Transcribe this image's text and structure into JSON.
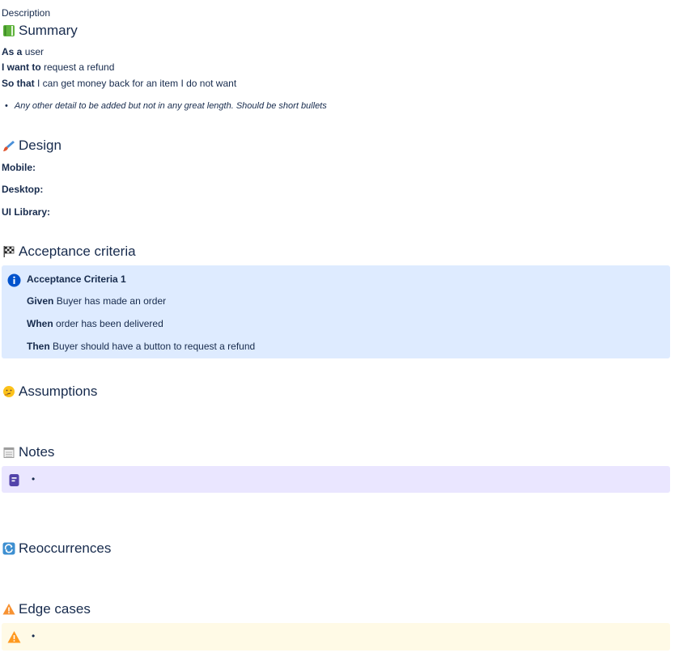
{
  "label": "Description",
  "summary": {
    "heading": "Summary",
    "icon": "green-book-icon",
    "as_a_label": "As a",
    "as_a_value": "user",
    "i_want_label": "I want to",
    "i_want_value": "request a refund",
    "so_that_label": "So that",
    "so_that_value": "I can get money back for an item I do not want",
    "bullet": "Any other detail to be added but not in any great length. Should be short bullets"
  },
  "design": {
    "heading": "Design",
    "icon": "paintbrush-icon",
    "mobile": "Mobile:",
    "desktop": "Desktop:",
    "ui_library": "UI Library:"
  },
  "acceptance": {
    "heading": "Acceptance criteria",
    "icon": "checkered-flag-icon",
    "panel": {
      "title": "Acceptance Criteria 1",
      "given_label": "Given",
      "given_value": "Buyer has made an order",
      "when_label": "When",
      "when_value": "order has been delivered",
      "then_label": "Then",
      "then_value": "Buyer should have a button to request a refund",
      "color": "#deebff"
    }
  },
  "assumptions": {
    "heading": "Assumptions",
    "icon": "thinking-face-icon"
  },
  "notes": {
    "heading": "Notes",
    "icon": "spiral-notepad-icon",
    "bullet": "•",
    "color": "#eae6ff"
  },
  "reoccurrences": {
    "heading": "Reoccurrences",
    "icon": "repeat-arrows-icon"
  },
  "edge_cases": {
    "heading": "Edge cases",
    "icon": "warning-icon",
    "bullet": "•",
    "color": "#fffae6"
  }
}
